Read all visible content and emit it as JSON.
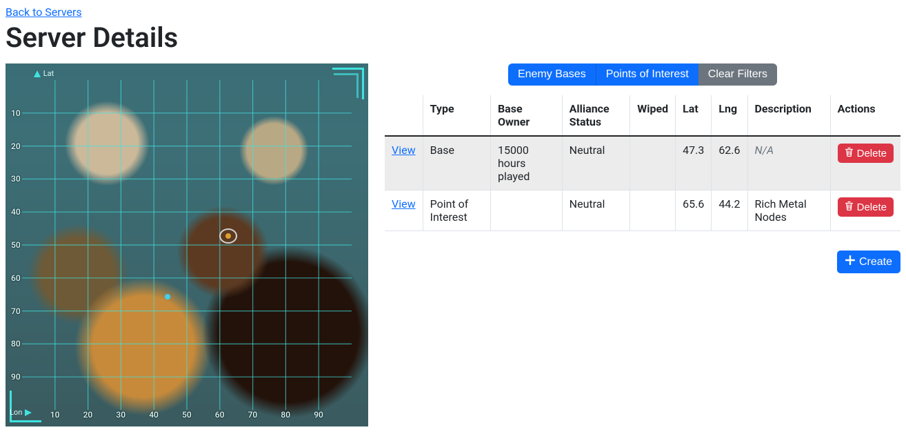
{
  "nav": {
    "back_label": "Back to Servers"
  },
  "page": {
    "title": "Server Details"
  },
  "map": {
    "lat_label": "Lat",
    "lon_label": "Lon",
    "ticks": [
      "10",
      "20",
      "30",
      "40",
      "50",
      "60",
      "70",
      "80",
      "90"
    ],
    "markers": [
      {
        "kind": "base_circle",
        "lat": 47.3,
        "lng": 62.6,
        "color": "#e0a030"
      },
      {
        "kind": "poi_dot",
        "lat": 65.6,
        "lng": 44.2,
        "color": "#40d0f0"
      }
    ]
  },
  "filters": {
    "enemy_bases": "Enemy Bases",
    "points_of_interest": "Points of Interest",
    "clear": "Clear Filters"
  },
  "table": {
    "headers": {
      "view": "",
      "type": "Type",
      "base_owner": "Base Owner",
      "alliance_status": "Alliance Status",
      "wiped": "Wiped",
      "lat": "Lat",
      "lng": "Lng",
      "description": "Description",
      "actions": "Actions"
    },
    "view_label": "View",
    "delete_label": "Delete",
    "rows": [
      {
        "selected": true,
        "type": "Base",
        "base_owner": "15000 hours played",
        "alliance_status": "Neutral",
        "wiped": "",
        "lat": "47.3",
        "lng": "62.6",
        "description": "N/A",
        "description_na": true
      },
      {
        "selected": false,
        "type": "Point of Interest",
        "base_owner": "",
        "alliance_status": "Neutral",
        "wiped": "",
        "lat": "65.6",
        "lng": "44.2",
        "description": "Rich Metal Nodes",
        "description_na": false
      }
    ]
  },
  "actions": {
    "create": "Create"
  }
}
